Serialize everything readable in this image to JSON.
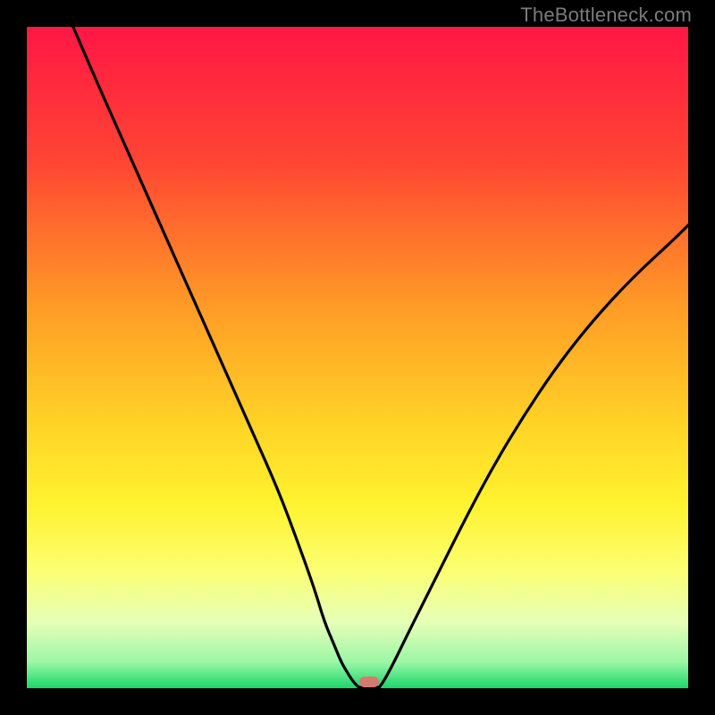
{
  "watermark": "TheBottleneck.com",
  "chart_data": {
    "type": "line",
    "title": "",
    "xlabel": "",
    "ylabel": "",
    "xlim": [
      0,
      100
    ],
    "ylim": [
      0,
      100
    ],
    "grid": false,
    "legend": false,
    "gradient_stops": [
      {
        "pct": 0,
        "color": "#ff1745"
      },
      {
        "pct": 20,
        "color": "#ff4433"
      },
      {
        "pct": 42,
        "color": "#ff9a26"
      },
      {
        "pct": 60,
        "color": "#ffd326"
      },
      {
        "pct": 72,
        "color": "#fff22e"
      },
      {
        "pct": 82,
        "color": "#fcff70"
      },
      {
        "pct": 90,
        "color": "#e6ffb8"
      },
      {
        "pct": 96,
        "color": "#9cf7a6"
      },
      {
        "pct": 100,
        "color": "#1bd66a"
      }
    ],
    "series": [
      {
        "name": "left-branch",
        "x": [
          7,
          10,
          14,
          18,
          22,
          26,
          30,
          34,
          38,
          41,
          43.5,
          45,
          46.5,
          47.5,
          48.5,
          49.2,
          49.8,
          50.2
        ],
        "y": [
          100,
          93,
          84,
          75,
          66,
          57,
          48,
          39,
          30,
          22,
          15,
          10,
          6.5,
          4,
          2.3,
          1.2,
          0.5,
          0.15
        ]
      },
      {
        "name": "right-branch",
        "x": [
          53.3,
          53.8,
          54.6,
          55.8,
          57.5,
          60,
          63,
          66.5,
          70.5,
          75,
          80,
          85.5,
          91.5,
          98,
          100
        ],
        "y": [
          0.15,
          0.8,
          2.2,
          4.5,
          8,
          13,
          19,
          26,
          33.5,
          41,
          48.5,
          55.5,
          62,
          68,
          70
        ]
      },
      {
        "name": "flat-bottom",
        "x": [
          50.2,
          51,
          52,
          53.3
        ],
        "y": [
          0.15,
          0.05,
          0.05,
          0.15
        ]
      }
    ],
    "marker": {
      "x": 51.7,
      "y": 1.0,
      "color": "#d9786f"
    },
    "curve_color": "#000000",
    "curve_width": 3.2
  }
}
